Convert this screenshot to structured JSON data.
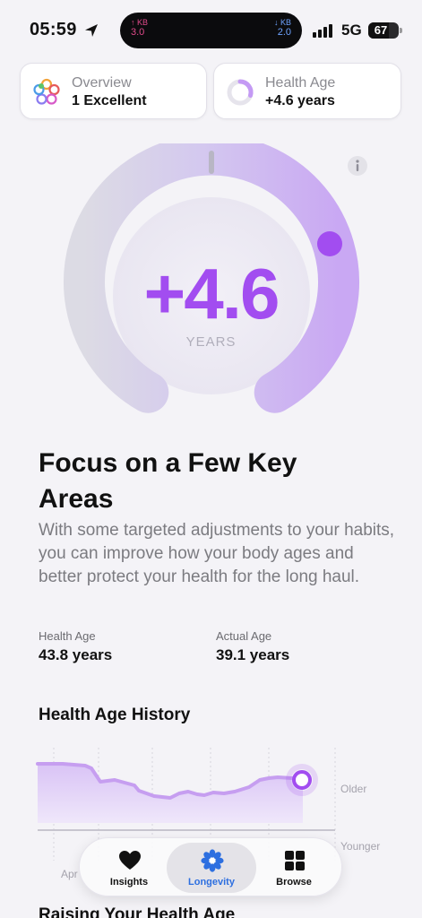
{
  "status": {
    "time": "05:59",
    "upload_unit": "↑ KB",
    "upload_value": "3.0",
    "download_unit": "↓ KB",
    "download_value": "2.0",
    "network": "5G",
    "battery": "67"
  },
  "cards": {
    "overview": {
      "label": "Overview",
      "value": "1 Excellent"
    },
    "health_age": {
      "label": "Health Age",
      "value": "+4.6 years"
    }
  },
  "gauge": {
    "value": "+4.6",
    "unit": "YEARS",
    "indicator_level": 0.62
  },
  "focus": {
    "title": "Focus on a Few Key Areas",
    "description": "With some targeted adjustments to your habits, you can improve how your body ages and better protect your health for the long haul."
  },
  "ages": {
    "health": {
      "label": "Health Age",
      "value": "43.8 years"
    },
    "actual": {
      "label": "Actual Age",
      "value": "39.1 years"
    }
  },
  "history": {
    "title": "Health Age History",
    "older_label": "Older",
    "younger_label": "Younger",
    "month_label": "Apr"
  },
  "next_section_title": "Raising Your Health Age",
  "tabs": [
    {
      "label": "Insights",
      "icon": "heart-icon",
      "active": false
    },
    {
      "label": "Longevity",
      "icon": "flower-icon",
      "active": true
    },
    {
      "label": "Browse",
      "icon": "grid-icon",
      "active": false
    }
  ],
  "colors": {
    "accent": "#a24df0",
    "tab_active": "#2d6fe0"
  }
}
